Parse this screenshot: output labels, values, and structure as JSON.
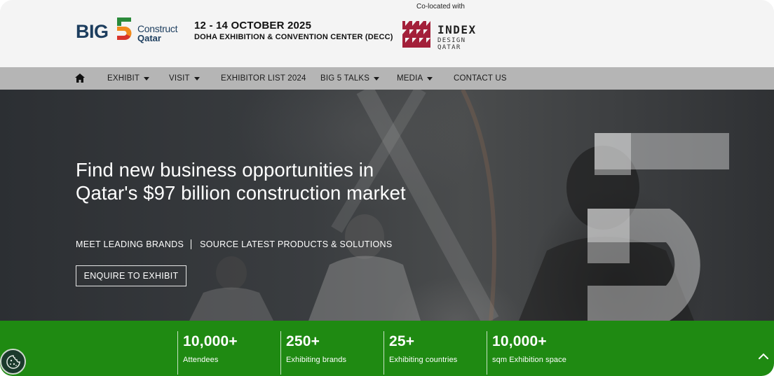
{
  "header": {
    "logo": {
      "big": "BIG",
      "construct": "Construct",
      "qatar": "Qatar"
    },
    "event_date": "12 - 14 OCTOBER 2025",
    "event_venue": "DOHA EXHIBITION & CONVENTION CENTER (DECC)",
    "colocated_label": "Co-located with",
    "partner_logo": {
      "title": "INDEX",
      "subtitle": "DESIGN QATAR"
    }
  },
  "nav": {
    "home_icon": "home-icon",
    "items": [
      {
        "label": "EXHIBIT",
        "dropdown": true
      },
      {
        "label": "VISIT",
        "dropdown": true
      },
      {
        "label": "EXHIBITOR LIST 2024",
        "dropdown": false
      },
      {
        "label": "BIG 5 TALKS",
        "dropdown": true
      },
      {
        "label": "MEDIA",
        "dropdown": true
      },
      {
        "label": "CONTACT US",
        "dropdown": false
      }
    ]
  },
  "hero": {
    "title": "Find new business opportunities in Qatar's $97 billion construction market",
    "sub_left": "MEET LEADING BRANDS",
    "sub_right": "SOURCE LATEST PRODUCTS & SOLUTIONS",
    "cta_label": "ENQUIRE TO EXHIBIT"
  },
  "stats": [
    {
      "value": "10,000+",
      "label": "Attendees"
    },
    {
      "value": "250+",
      "label": "Exhibiting brands"
    },
    {
      "value": "25+",
      "label": "Exhibiting countries"
    },
    {
      "value": "10,000+",
      "label": "sqm Exhibition space"
    }
  ],
  "colors": {
    "brand_navy": "#1c3d5e",
    "stats_green": "#1f8a12",
    "nav_gray": "#b5b5b5",
    "index_red": "#a3203a"
  },
  "icons": {
    "cookie": "cookie-icon",
    "back_to_top": "chevron-up-icon"
  }
}
